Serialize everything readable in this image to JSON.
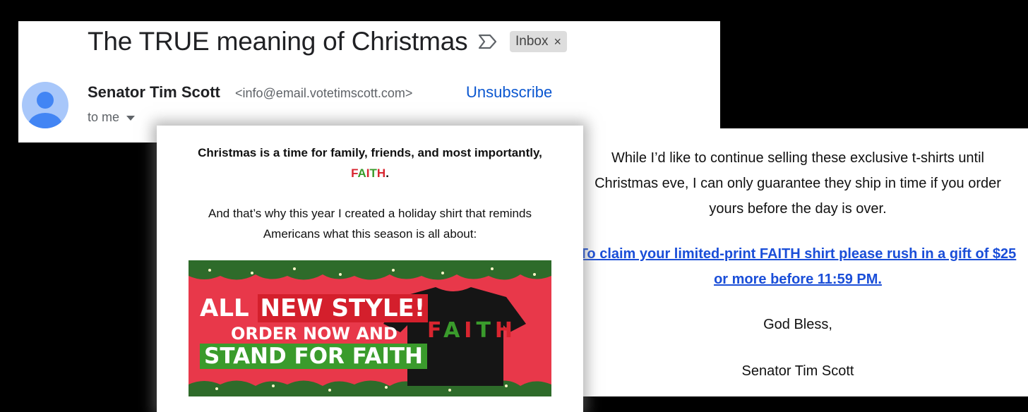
{
  "email_header": {
    "subject": "The TRUE meaning of Christmas",
    "label_badge": "Inbox",
    "label_remove_glyph": "×",
    "sender_name": "Senator Tim Scott",
    "sender_email": "<info@email.votetimscott.com>",
    "unsubscribe_label": "Unsubscribe",
    "recipient_label": "to me"
  },
  "email_body": {
    "intro_bold_before": "Christmas is a time for family, friends, and most importantly, ",
    "intro_faith": [
      "F",
      "A",
      "I",
      "T",
      "H"
    ],
    "intro_bold_after": ".",
    "intro_para": "And that’s why this year I created a holiday shirt that reminds Americans what this season is all about:",
    "banner": {
      "line1_pre": "ALL",
      "line1_highlight": "NEW STYLE!",
      "line2": "ORDER NOW AND",
      "line3": "STAND FOR FAITH",
      "shirt_text": [
        "F",
        "A",
        "I",
        "T",
        "H"
      ]
    }
  },
  "right_panel": {
    "paragraph": "While I’d like to continue selling these exclusive t-shirts until Christmas eve, I can only guarantee they ship in time if you order yours before the day is over.",
    "claim_link": "To claim your limited-print FAITH shirt please rush in a gift of $25 or more before 11:59 PM.",
    "closing": "God Bless,",
    "signature": "Senator Tim Scott"
  },
  "colors": {
    "accent_blue": "#0b57d0",
    "link_blue": "#1a4ed8",
    "faith_red": "#d8252f",
    "faith_green": "#3a9b2c",
    "banner_red": "#e8384a"
  },
  "icons": {
    "important": "important-marker-icon",
    "avatar": "default-avatar-icon",
    "caret": "chevron-down-icon"
  }
}
